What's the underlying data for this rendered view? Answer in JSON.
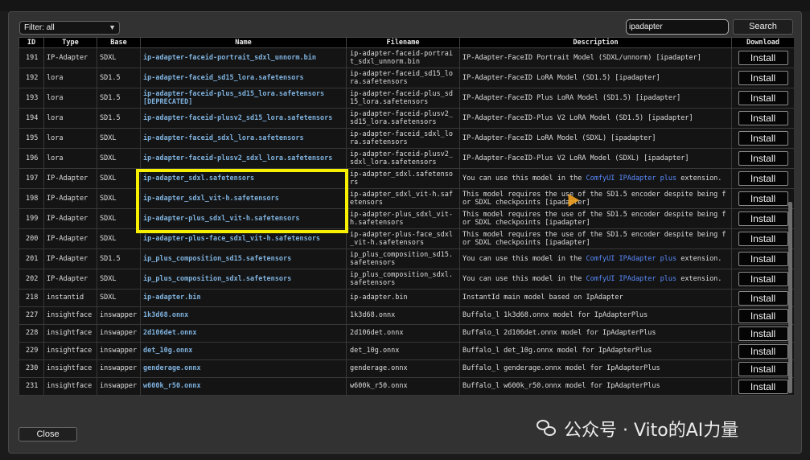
{
  "filter": {
    "value": "Filter: all"
  },
  "search": {
    "value": "ipadapter",
    "button_label": "Search"
  },
  "table": {
    "headers": [
      "ID",
      "Type",
      "Base",
      "Name",
      "Filename",
      "Description",
      "Download"
    ],
    "rows": [
      {
        "id": "191",
        "type": "IP-Adapter",
        "base": "SDXL",
        "name": "ip-adapter-faceid-portrait_sdxl_unnorm.bin",
        "name_extra": "",
        "filename": "ip-adapter-faceid-portrait_sdxl_unnorm.bin",
        "desc": "IP-Adapter-FaceID Portrait Model (SDXL/unnorm) [ipadapter]",
        "desc_link": "",
        "desc_after": "",
        "install": "Install"
      },
      {
        "id": "192",
        "type": "lora",
        "base": "SD1.5",
        "name": "ip-adapter-faceid_sd15_lora.safetensors",
        "name_extra": "",
        "filename": "ip-adapter-faceid_sd15_lora.safetensors",
        "desc": "IP-Adapter-FaceID LoRA Model (SD1.5) [ipadapter]",
        "desc_link": "",
        "desc_after": "",
        "install": "Install"
      },
      {
        "id": "193",
        "type": "lora",
        "base": "SD1.5",
        "name": "ip-adapter-faceid-plus_sd15_lora.safetensors",
        "name_extra": "[DEPRECATED]",
        "filename": "ip-adapter-faceid-plus_sd15_lora.safetensors",
        "desc": "IP-Adapter-FaceID Plus LoRA Model (SD1.5) [ipadapter]",
        "desc_link": "",
        "desc_after": "",
        "install": "Install"
      },
      {
        "id": "194",
        "type": "lora",
        "base": "SD1.5",
        "name": "ip-adapter-faceid-plusv2_sd15_lora.safetensors",
        "name_extra": "",
        "filename": "ip-adapter-faceid-plusv2_sd15_lora.safetensors",
        "desc": "IP-Adapter-FaceID-Plus V2 LoRA Model (SD1.5) [ipadapter]",
        "desc_link": "",
        "desc_after": "",
        "install": "Install"
      },
      {
        "id": "195",
        "type": "lora",
        "base": "SDXL",
        "name": "ip-adapter-faceid_sdxl_lora.safetensors",
        "name_extra": "",
        "filename": "ip-adapter-faceid_sdxl_lora.safetensors",
        "desc": "IP-Adapter-FaceID LoRA Model (SDXL) [ipadapter]",
        "desc_link": "",
        "desc_after": "",
        "install": "Install"
      },
      {
        "id": "196",
        "type": "lora",
        "base": "SDXL",
        "name": "ip-adapter-faceid-plusv2_sdxl_lora.safetensors",
        "name_extra": "",
        "filename": "ip-adapter-faceid-plusv2_sdxl_lora.safetensors",
        "desc": "IP-Adapter-FaceID-Plus V2 LoRA Model (SDXL) [ipadapter]",
        "desc_link": "",
        "desc_after": "",
        "install": "Install"
      },
      {
        "id": "197",
        "type": "IP-Adapter",
        "base": "SDXL",
        "name": "ip-adapter_sdxl.safetensors",
        "name_extra": "",
        "filename": "ip-adapter_sdxl.safetensors",
        "desc": "You can use this model in the ",
        "desc_link": "ComfyUI IPAdapter plus",
        "desc_after": " extension.",
        "install": "Install"
      },
      {
        "id": "198",
        "type": "IP-Adapter",
        "base": "SDXL",
        "name": "ip-adapter_sdxl_vit-h.safetensors",
        "name_extra": "",
        "filename": "ip-adapter_sdxl_vit-h.safetensors",
        "desc": "This model requires the use of the SD1.5 encoder despite being for SDXL checkpoints [ipadapter]",
        "desc_link": "",
        "desc_after": "",
        "install": "Install"
      },
      {
        "id": "199",
        "type": "IP-Adapter",
        "base": "SDXL",
        "name": "ip-adapter-plus_sdxl_vit-h.safetensors",
        "name_extra": "",
        "filename": "ip-adapter-plus_sdxl_vit-h.safetensors",
        "desc": "This model requires the use of the SD1.5 encoder despite being for SDXL checkpoints [ipadapter]",
        "desc_link": "",
        "desc_after": "",
        "install": "Install"
      },
      {
        "id": "200",
        "type": "IP-Adapter",
        "base": "SDXL",
        "name": "ip-adapter-plus-face_sdxl_vit-h.safetensors",
        "name_extra": "",
        "filename": "ip-adapter-plus-face_sdxl_vit-h.safetensors",
        "desc": "This model requires the use of the SD1.5 encoder despite being for SDXL checkpoints [ipadapter]",
        "desc_link": "",
        "desc_after": "",
        "install": "Install"
      },
      {
        "id": "201",
        "type": "IP-Adapter",
        "base": "SD1.5",
        "name": "ip_plus_composition_sd15.safetensors",
        "name_extra": "",
        "filename": "ip_plus_composition_sd15.safetensors",
        "desc": "You can use this model in the ",
        "desc_link": "ComfyUI IPAdapter plus",
        "desc_after": " extension.",
        "install": "Install"
      },
      {
        "id": "202",
        "type": "IP-Adapter",
        "base": "SDXL",
        "name": "ip_plus_composition_sdxl.safetensors",
        "name_extra": "",
        "filename": "ip_plus_composition_sdxl.safetensors",
        "desc": "You can use this model in the ",
        "desc_link": "ComfyUI IPAdapter plus",
        "desc_after": " extension.",
        "install": "Install"
      },
      {
        "id": "218",
        "type": "instantid",
        "base": "SDXL",
        "name": "ip-adapter.bin",
        "name_extra": "",
        "filename": "ip-adapter.bin",
        "desc": "InstantId main model based on IpAdapter",
        "desc_link": "",
        "desc_after": "",
        "install": "Install"
      },
      {
        "id": "227",
        "type": "insightface",
        "base": "inswapper",
        "name": "1k3d68.onnx",
        "name_extra": "",
        "filename": "1k3d68.onnx",
        "desc": "Buffalo_l 1k3d68.onnx model for IpAdapterPlus",
        "desc_link": "",
        "desc_after": "",
        "install": "Install"
      },
      {
        "id": "228",
        "type": "insightface",
        "base": "inswapper",
        "name": "2d106det.onnx",
        "name_extra": "",
        "filename": "2d106det.onnx",
        "desc": "Buffalo_l 2d106det.onnx model for IpAdapterPlus",
        "desc_link": "",
        "desc_after": "",
        "install": "Install"
      },
      {
        "id": "229",
        "type": "insightface",
        "base": "inswapper",
        "name": "det_10g.onnx",
        "name_extra": "",
        "filename": "det_10g.onnx",
        "desc": "Buffalo_l det_10g.onnx model for IpAdapterPlus",
        "desc_link": "",
        "desc_after": "",
        "install": "Install"
      },
      {
        "id": "230",
        "type": "insightface",
        "base": "inswapper",
        "name": "genderage.onnx",
        "name_extra": "",
        "filename": "genderage.onnx",
        "desc": "Buffalo_l genderage.onnx model for IpAdapterPlus",
        "desc_link": "",
        "desc_after": "",
        "install": "Install"
      },
      {
        "id": "231",
        "type": "insightface",
        "base": "inswapper",
        "name": "w600k_r50.onnx",
        "name_extra": "",
        "filename": "w600k_r50.onnx",
        "desc": "Buffalo_l w600k_r50.onnx model for IpAdapterPlus",
        "desc_link": "",
        "desc_after": "",
        "install": "Install"
      }
    ]
  },
  "footer": {
    "close_label": "Close"
  },
  "watermark": {
    "text": "公众号 · Vito的AI力量"
  },
  "colors": {
    "highlight": "#f7f000",
    "link": "#7fb2de",
    "accent_link": "#5a8cff"
  }
}
